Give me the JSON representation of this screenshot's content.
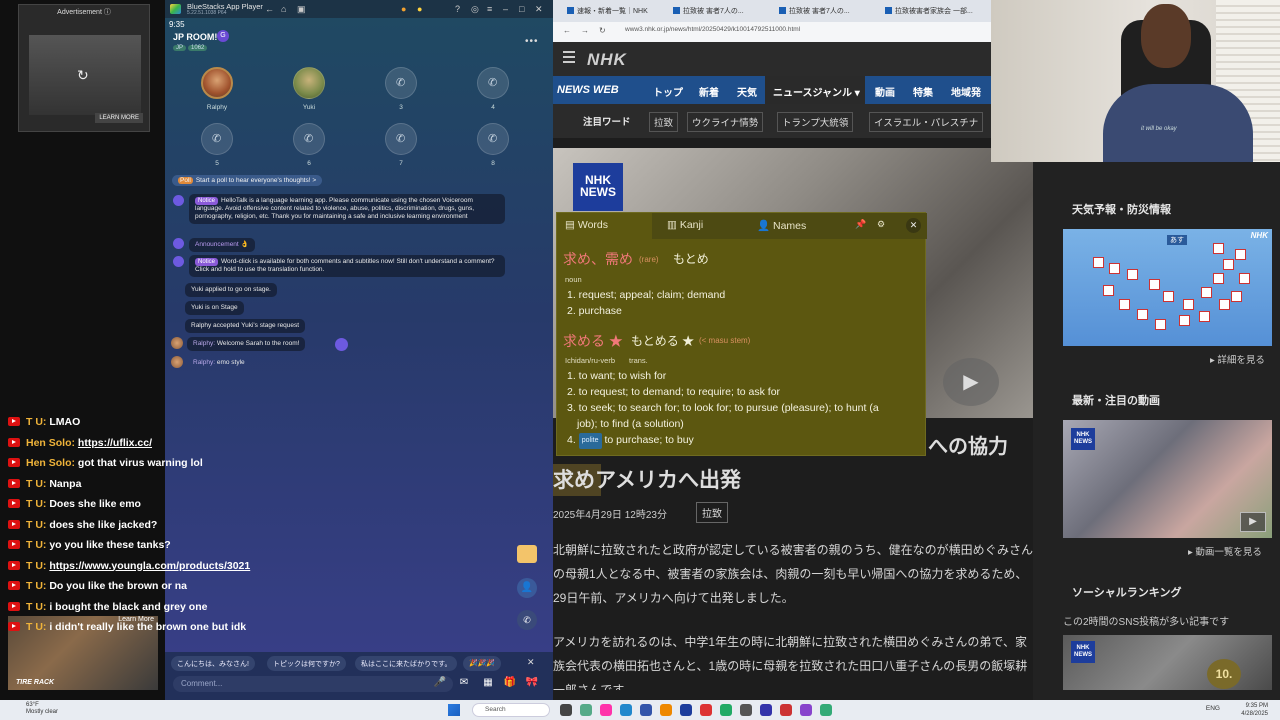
{
  "stream": {
    "ad_label": "Advertisement ⓘ",
    "ad_learn": "LEARN MORE",
    "chat": [
      {
        "author": "T U:",
        "text": "LMAO",
        "link": false
      },
      {
        "author": "Hen Solo:",
        "text": "https://uflix.cc/",
        "link": true
      },
      {
        "author": "Hen Solo:",
        "text": "got that virus warning lol",
        "link": false
      },
      {
        "author": "T U:",
        "text": "Nanpa",
        "link": false
      },
      {
        "author": "T U:",
        "text": "Does she like emo",
        "link": false
      },
      {
        "author": "T U:",
        "text": "does she like jacked?",
        "link": false
      },
      {
        "author": "T U:",
        "text": "yo you like these tanks?",
        "link": false
      },
      {
        "author": "T U:",
        "text": "https://www.youngla.com/products/3021",
        "link": true
      },
      {
        "author": "T U:",
        "text": "Do you like the brown or na",
        "link": false
      },
      {
        "author": "T U:",
        "text": "i bought the black and grey one",
        "link": false
      },
      {
        "author": "T U:",
        "text": "i didn't really like the brown one but idk",
        "link": false
      }
    ],
    "cam_brand": "TIRE RACK",
    "cam_learn": "Learn More"
  },
  "bluestacks": {
    "title": "BlueStacks App Player",
    "subtitle": "5.22.51.1038  P64",
    "time": "9:35",
    "room_title": "JP ROOM!",
    "room_badge": "G",
    "tag1": "JP",
    "tag2": "1062",
    "more": "•••",
    "seats": [
      {
        "label": "Ralphy"
      },
      {
        "label": "Yuki"
      },
      {
        "label": "3"
      },
      {
        "label": "4"
      },
      {
        "label": "5"
      },
      {
        "label": "6"
      },
      {
        "label": "7"
      },
      {
        "label": "8"
      }
    ],
    "poll_tag": "Poll",
    "poll_text": "Start a poll to hear everyone's thoughts! >",
    "notice_tag": "Notice",
    "notice1": "HelloTalk is a language learning app. Please communicate using the chosen Voiceroom language. Avoid offensive content related to violence, abuse, politics, discrimination, drugs, guns, pornography, religion, etc. Thank you for maintaining a safe and inclusive learning environment",
    "announcement": "Announcement 👌",
    "notice2": "Word-click is available for both comments and subtitles now! Still don't understand a comment? Click and hold to use the translation function.",
    "event1": "Yuki applied to go on stage.",
    "event2": "Yuki is on Stage",
    "event3": "Ralphy accepted Yuki's stage request",
    "msg1_author": "Ralphy:",
    "msg1_text": "Welcome Sarah to the room!",
    "msg2_author": "Ralphy:",
    "msg2_text": "emo style",
    "quick": [
      "こんにちは、みなさん!",
      "トピックは何ですか?",
      "私はここに来たばかりです。",
      "🎉🎉🎉"
    ],
    "comment_placeholder": "Comment..."
  },
  "browser": {
    "tabs": [
      "速報・新着一覧｜NHK",
      "拉致被 害者7人の...",
      "拉致被 害者7人の...",
      "拉致被害者家族会 一部..."
    ],
    "address": "www3.nhk.or.jp/news/html/20250429/k10014792511000.html"
  },
  "nhk": {
    "logo": "NHK",
    "nav": [
      "NEWS WEB",
      "トップ",
      "新着",
      "天気",
      "ニュースジャンル ▾",
      "動画",
      "特集",
      "地域発"
    ],
    "sub_label": "注目ワード",
    "sub_words": [
      "拉致",
      "ウクライナ情勢",
      "トランプ大統領",
      "イスラエル・パレスチナ"
    ],
    "hero_logo_1": "NHK",
    "hero_logo_2": "NEWS",
    "title_tail": "への協力",
    "title_main": "求めアメリカへ出発",
    "date": "2025年4月29日 12時23分",
    "category": "拉致",
    "para1": "北朝鮮に拉致されたと政府が認定している被害者の親のうち、健在なのが横田めぐみさんの母親1人となる中、被害者の家族会は、肉親の一刻も早い帰国への協力を求めるため、29日午前、アメリカへ向けて出発しました。",
    "para2": "アメリカを訪れるのは、中学1年生の時に北朝鮮に拉致された横田めぐみさんの弟で、家族会代表の横田拓也さんと、1歳の時に母親を拉致された田口八重子さんの長男の飯塚耕一郎さんです。",
    "weather_title": "天気予報・防災情報",
    "weather_map_tag": "あす",
    "weather_more": "▸ 詳細を見る",
    "videos_title": "最新・注目の動画",
    "videos_more": "▸ 動画一覧を見る",
    "ranking_title": "ソーシャルランキング",
    "ranking_sub": "この2時間のSNS投稿が多い記事です",
    "ranking_num": "10."
  },
  "dictionary": {
    "tabs": [
      "Words",
      "Kanji",
      "Names"
    ],
    "close": "✕",
    "entry1_kanji": "求め、需め",
    "entry1_tag": "(rare)",
    "entry1_kana": "もとめ",
    "entry1_pos": "noun",
    "entry1_defs": [
      "1. request; appeal; claim; demand",
      "2. purchase"
    ],
    "entry2_kanji": "求める ★",
    "entry2_kana": "もとめる ★",
    "entry2_tag": "(< masu stem)",
    "entry2_pos": "Ichidan/ru-verb",
    "entry2_pos2": "trans.",
    "entry2_defs": [
      "1. to want; to wish for",
      "2. to request; to demand; to require; to ask for",
      "3. to seek; to search for; to look for; to pursue (pleasure); to hunt (a",
      "job); to find (a solution)"
    ],
    "entry2_def4_prefix": "4.",
    "entry2_def4_tag": "polite",
    "entry2_def4": "to purchase; to buy"
  },
  "webcam": {
    "shirt_text": "it will be okay"
  },
  "taskbar": {
    "weather": "63°F",
    "weather2": "Mostly clear",
    "search": "Search",
    "tray": "ENG",
    "time": "9:35 PM",
    "date": "4/28/2025"
  }
}
